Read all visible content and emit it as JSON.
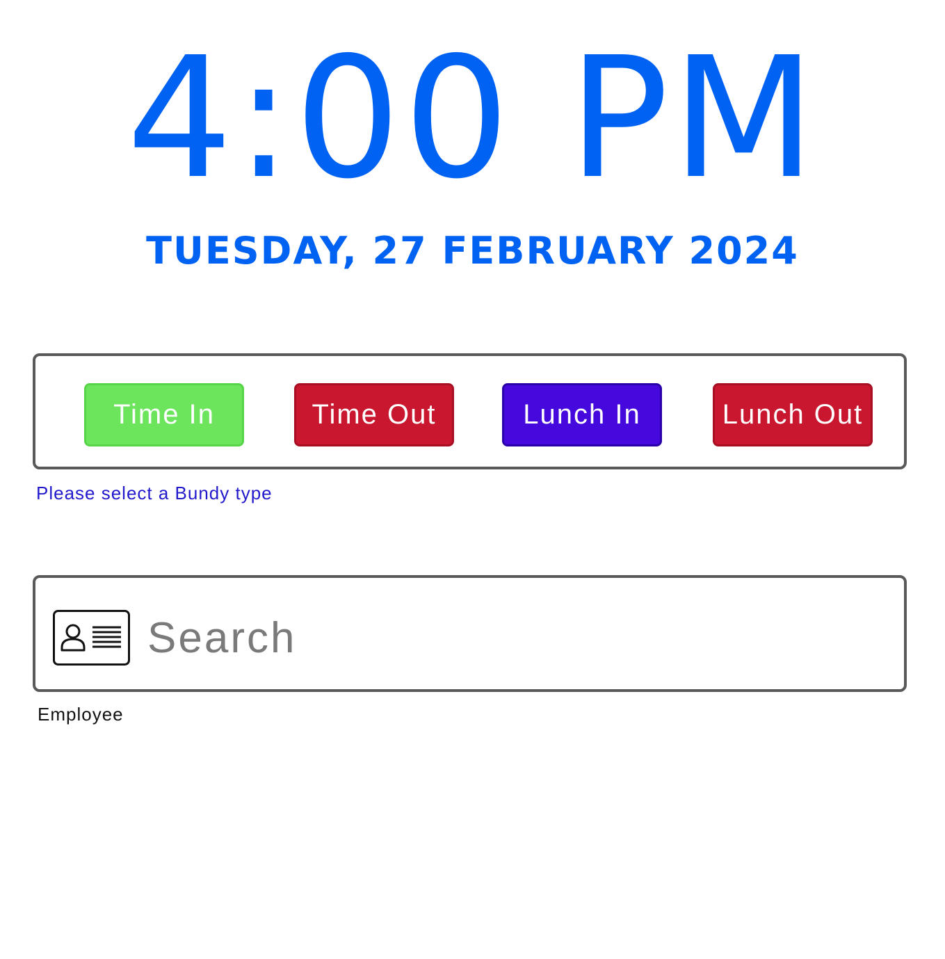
{
  "clock": {
    "time": "4:00 PM",
    "date": "TUESDAY, 27 FEBRUARY 2024"
  },
  "bundy": {
    "buttons": [
      {
        "label": "Time In",
        "color": "#6ce55d"
      },
      {
        "label": "Time Out",
        "color": "#c8172e"
      },
      {
        "label": "Lunch In",
        "color": "#4609dd"
      },
      {
        "label": "Lunch Out",
        "color": "#c8172e"
      }
    ],
    "helper_text": "Please select a Bundy type"
  },
  "search": {
    "icon": "id-card-icon",
    "placeholder": "Search",
    "value": "",
    "label": "Employee"
  },
  "colors": {
    "accent": "#0062f2",
    "helper": "#2219cc"
  }
}
